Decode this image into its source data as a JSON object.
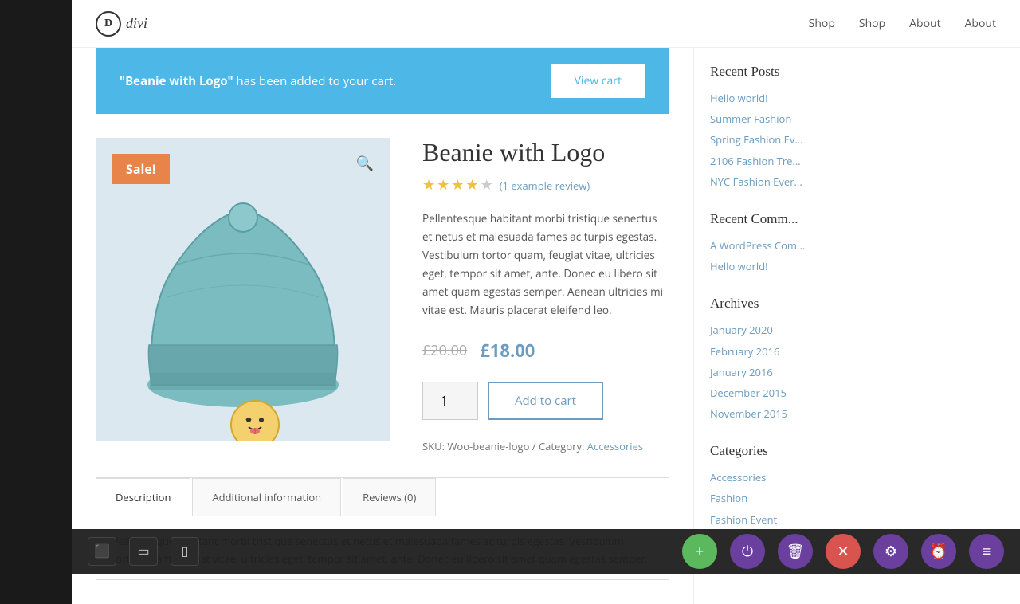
{
  "header": {
    "logo_letter": "D",
    "logo_text": "divi",
    "nav": [
      {
        "label": "Shop",
        "href": "#"
      },
      {
        "label": "Shop",
        "href": "#"
      },
      {
        "label": "About",
        "href": "#"
      },
      {
        "label": "About",
        "href": "#"
      }
    ]
  },
  "cart_notification": {
    "text_pre": "“Beanie with Logo” has been added to your cart.",
    "view_cart_label": "View cart"
  },
  "product": {
    "title": "Beanie with Logo",
    "rating_count": "(1 example review)",
    "description": "Pellentesque habitant morbi tristique senectus et netus et malesuada fames ac turpis egestas. Vestibulum tortor quam, feugiat vitae, ultricies eget, tempor sit amet, ante. Donec eu libero sit amet quam egestas semper. Aenean ultricies mi vitae est. Mauris placerat eleifend leo.",
    "original_price": "£20.00",
    "sale_price": "£18.00",
    "qty_value": "1",
    "add_to_cart_label": "Add to cart",
    "sku_label": "SKU:",
    "sku_value": "Woo-beanie-logo",
    "category_label": "Category:",
    "category_value": "Accessories",
    "sale_badge": "Sale!"
  },
  "tabs": [
    {
      "label": "Description",
      "active": true
    },
    {
      "label": "Additional information",
      "active": false
    },
    {
      "label": "Reviews (0)",
      "active": false
    }
  ],
  "tab_content": "Pellentesque habitant morbi tristique senectus et netus et malesuada fames ac turpis egestas. Vestibulum tortor quam, feugiat vitae, ultricies eget, tempor sit amet, ante. Donec eu libero sit amet quam egestas semper.",
  "sidebar": {
    "recent_posts_title": "Recent Posts",
    "recent_posts": [
      {
        "label": "Hello world!",
        "href": "#"
      },
      {
        "label": "Summer Fashion",
        "href": "#"
      },
      {
        "label": "Spring Fashion Ev...",
        "href": "#"
      },
      {
        "label": "2106 Fashion Tre...",
        "href": "#"
      },
      {
        "label": "NYC Fashion Ever...",
        "href": "#"
      }
    ],
    "recent_comments_title": "Recent Comm...",
    "recent_comments": [
      {
        "label": "A WordPress Com...",
        "href": "#"
      },
      {
        "label": "Hello world!",
        "href": "#"
      }
    ],
    "archives_title": "Archives",
    "archives": [
      {
        "label": "January 2020",
        "href": "#"
      },
      {
        "label": "February 2016",
        "href": "#"
      },
      {
        "label": "January 2016",
        "href": "#"
      },
      {
        "label": "December 2015",
        "href": "#"
      },
      {
        "label": "November 2015",
        "href": "#"
      }
    ],
    "categories_title": "Categories",
    "categories": [
      {
        "label": "Accessories",
        "href": "#"
      },
      {
        "label": "Fashion",
        "href": "#"
      },
      {
        "label": "Fashion Event",
        "href": "#"
      }
    ]
  },
  "toolbar": {
    "icons": [
      {
        "name": "desktop-icon",
        "symbol": "🖥"
      },
      {
        "name": "tablet-icon",
        "symbol": "▭"
      },
      {
        "name": "mobile-icon",
        "symbol": "▯"
      }
    ],
    "actions": [
      {
        "name": "add-button",
        "symbol": "+",
        "color": "btn-green"
      },
      {
        "name": "power-button",
        "symbol": "⏻",
        "color": "btn-purple"
      },
      {
        "name": "trash-button",
        "symbol": "🗑",
        "color": "btn-purple"
      },
      {
        "name": "close-button",
        "symbol": "✕",
        "color": "btn-close"
      },
      {
        "name": "settings-button",
        "symbol": "⚙",
        "color": "btn-settings"
      },
      {
        "name": "time-button",
        "symbol": "⏰",
        "color": "btn-time"
      },
      {
        "name": "bars-button",
        "symbol": "⣿",
        "color": "btn-bars"
      }
    ]
  }
}
